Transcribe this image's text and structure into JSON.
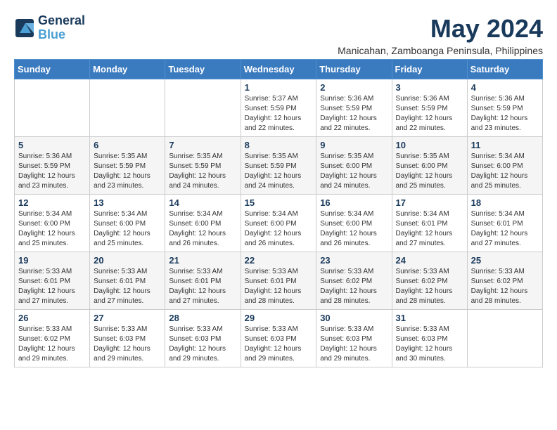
{
  "logo": {
    "line1": "General",
    "line2": "Blue"
  },
  "title": "May 2024",
  "subtitle": "Manicahan, Zamboanga Peninsula, Philippines",
  "weekdays": [
    "Sunday",
    "Monday",
    "Tuesday",
    "Wednesday",
    "Thursday",
    "Friday",
    "Saturday"
  ],
  "weeks": [
    [
      {
        "day": "",
        "info": ""
      },
      {
        "day": "",
        "info": ""
      },
      {
        "day": "",
        "info": ""
      },
      {
        "day": "1",
        "info": "Sunrise: 5:37 AM\nSunset: 5:59 PM\nDaylight: 12 hours and 22 minutes."
      },
      {
        "day": "2",
        "info": "Sunrise: 5:36 AM\nSunset: 5:59 PM\nDaylight: 12 hours and 22 minutes."
      },
      {
        "day": "3",
        "info": "Sunrise: 5:36 AM\nSunset: 5:59 PM\nDaylight: 12 hours and 22 minutes."
      },
      {
        "day": "4",
        "info": "Sunrise: 5:36 AM\nSunset: 5:59 PM\nDaylight: 12 hours and 23 minutes."
      }
    ],
    [
      {
        "day": "5",
        "info": "Sunrise: 5:36 AM\nSunset: 5:59 PM\nDaylight: 12 hours and 23 minutes."
      },
      {
        "day": "6",
        "info": "Sunrise: 5:35 AM\nSunset: 5:59 PM\nDaylight: 12 hours and 23 minutes."
      },
      {
        "day": "7",
        "info": "Sunrise: 5:35 AM\nSunset: 5:59 PM\nDaylight: 12 hours and 24 minutes."
      },
      {
        "day": "8",
        "info": "Sunrise: 5:35 AM\nSunset: 5:59 PM\nDaylight: 12 hours and 24 minutes."
      },
      {
        "day": "9",
        "info": "Sunrise: 5:35 AM\nSunset: 6:00 PM\nDaylight: 12 hours and 24 minutes."
      },
      {
        "day": "10",
        "info": "Sunrise: 5:35 AM\nSunset: 6:00 PM\nDaylight: 12 hours and 25 minutes."
      },
      {
        "day": "11",
        "info": "Sunrise: 5:34 AM\nSunset: 6:00 PM\nDaylight: 12 hours and 25 minutes."
      }
    ],
    [
      {
        "day": "12",
        "info": "Sunrise: 5:34 AM\nSunset: 6:00 PM\nDaylight: 12 hours and 25 minutes."
      },
      {
        "day": "13",
        "info": "Sunrise: 5:34 AM\nSunset: 6:00 PM\nDaylight: 12 hours and 25 minutes."
      },
      {
        "day": "14",
        "info": "Sunrise: 5:34 AM\nSunset: 6:00 PM\nDaylight: 12 hours and 26 minutes."
      },
      {
        "day": "15",
        "info": "Sunrise: 5:34 AM\nSunset: 6:00 PM\nDaylight: 12 hours and 26 minutes."
      },
      {
        "day": "16",
        "info": "Sunrise: 5:34 AM\nSunset: 6:00 PM\nDaylight: 12 hours and 26 minutes."
      },
      {
        "day": "17",
        "info": "Sunrise: 5:34 AM\nSunset: 6:01 PM\nDaylight: 12 hours and 27 minutes."
      },
      {
        "day": "18",
        "info": "Sunrise: 5:34 AM\nSunset: 6:01 PM\nDaylight: 12 hours and 27 minutes."
      }
    ],
    [
      {
        "day": "19",
        "info": "Sunrise: 5:33 AM\nSunset: 6:01 PM\nDaylight: 12 hours and 27 minutes."
      },
      {
        "day": "20",
        "info": "Sunrise: 5:33 AM\nSunset: 6:01 PM\nDaylight: 12 hours and 27 minutes."
      },
      {
        "day": "21",
        "info": "Sunrise: 5:33 AM\nSunset: 6:01 PM\nDaylight: 12 hours and 27 minutes."
      },
      {
        "day": "22",
        "info": "Sunrise: 5:33 AM\nSunset: 6:01 PM\nDaylight: 12 hours and 28 minutes."
      },
      {
        "day": "23",
        "info": "Sunrise: 5:33 AM\nSunset: 6:02 PM\nDaylight: 12 hours and 28 minutes."
      },
      {
        "day": "24",
        "info": "Sunrise: 5:33 AM\nSunset: 6:02 PM\nDaylight: 12 hours and 28 minutes."
      },
      {
        "day": "25",
        "info": "Sunrise: 5:33 AM\nSunset: 6:02 PM\nDaylight: 12 hours and 28 minutes."
      }
    ],
    [
      {
        "day": "26",
        "info": "Sunrise: 5:33 AM\nSunset: 6:02 PM\nDaylight: 12 hours and 29 minutes."
      },
      {
        "day": "27",
        "info": "Sunrise: 5:33 AM\nSunset: 6:03 PM\nDaylight: 12 hours and 29 minutes."
      },
      {
        "day": "28",
        "info": "Sunrise: 5:33 AM\nSunset: 6:03 PM\nDaylight: 12 hours and 29 minutes."
      },
      {
        "day": "29",
        "info": "Sunrise: 5:33 AM\nSunset: 6:03 PM\nDaylight: 12 hours and 29 minutes."
      },
      {
        "day": "30",
        "info": "Sunrise: 5:33 AM\nSunset: 6:03 PM\nDaylight: 12 hours and 29 minutes."
      },
      {
        "day": "31",
        "info": "Sunrise: 5:33 AM\nSunset: 6:03 PM\nDaylight: 12 hours and 30 minutes."
      },
      {
        "day": "",
        "info": ""
      }
    ]
  ]
}
